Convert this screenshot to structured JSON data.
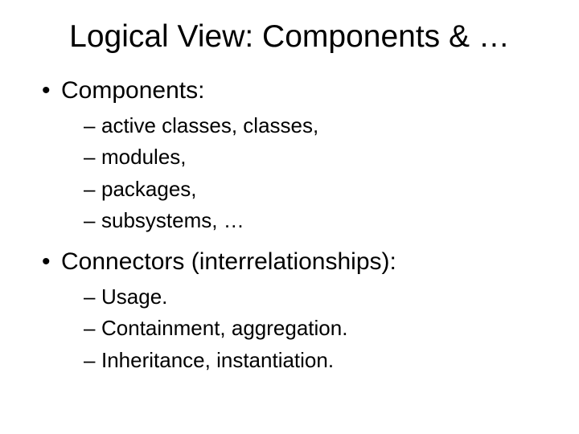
{
  "title": "Logical View: Components & …",
  "bullets": [
    {
      "label": "Components:",
      "sub": [
        "active classes, classes,",
        "modules,",
        "packages,",
        "subsystems, …"
      ]
    },
    {
      "label": "Connectors (interrelationships):",
      "sub": [
        "Usage.",
        "Containment, aggregation.",
        "Inheritance, instantiation."
      ]
    }
  ]
}
